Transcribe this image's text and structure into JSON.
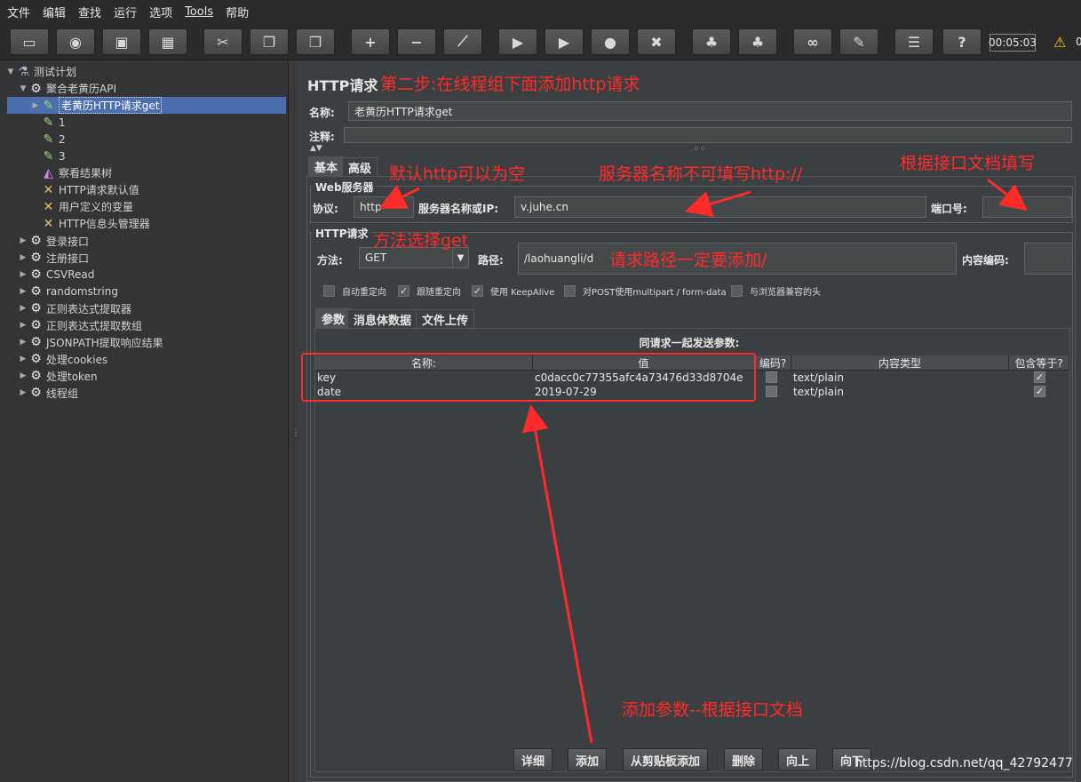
{
  "menu": [
    "文件",
    "编辑",
    "查找",
    "运行",
    "选项",
    "Tools",
    "帮助"
  ],
  "toolbar": {
    "buttons": [
      {
        "name": "new-plan-icon",
        "glyph": "▭"
      },
      {
        "name": "templates-icon",
        "glyph": "◉"
      },
      {
        "name": "open-icon",
        "glyph": "▣"
      },
      {
        "name": "save-icon",
        "glyph": "▦"
      },
      {
        "name": "cut-icon",
        "glyph": "✂"
      },
      {
        "name": "copy-icon",
        "glyph": "❐"
      },
      {
        "name": "paste-icon",
        "glyph": "❒"
      },
      {
        "name": "expand-icon",
        "glyph": "+"
      },
      {
        "name": "collapse-icon",
        "glyph": "−"
      },
      {
        "name": "toggle-icon",
        "glyph": "⟋"
      },
      {
        "name": "start-icon",
        "glyph": "▶"
      },
      {
        "name": "start-no-pause-icon",
        "glyph": "▶"
      },
      {
        "name": "stop-icon",
        "glyph": "●"
      },
      {
        "name": "shutdown-icon",
        "glyph": "✖"
      },
      {
        "name": "clear-icon",
        "glyph": "♣"
      },
      {
        "name": "clear-all-icon",
        "glyph": "♣"
      },
      {
        "name": "search-icon",
        "glyph": "∞"
      },
      {
        "name": "reset-search-icon",
        "glyph": "✎"
      },
      {
        "name": "function-helper-icon",
        "glyph": "☰"
      },
      {
        "name": "help-icon",
        "glyph": "?"
      }
    ],
    "timer": "00:05:03",
    "warning_count": "0"
  },
  "tree": [
    {
      "label": "测试计划",
      "icon": "flask-icon",
      "glyph": "⚗",
      "indent": 0,
      "arrow": "▼"
    },
    {
      "label": "聚合老黄历API",
      "icon": "gear-icon",
      "glyph": "⚙",
      "indent": 1,
      "arrow": "▼"
    },
    {
      "label": "老黄历HTTP请求get",
      "icon": "pipette-icon",
      "glyph": "✎",
      "indent": 2,
      "arrow": "▶",
      "selected": true
    },
    {
      "label": "1",
      "icon": "pipette-icon",
      "glyph": "✎",
      "indent": 2,
      "arrow": ""
    },
    {
      "label": "2",
      "icon": "pipette-icon",
      "glyph": "✎",
      "indent": 2,
      "arrow": ""
    },
    {
      "label": "3",
      "icon": "pipette-icon",
      "glyph": "✎",
      "indent": 2,
      "arrow": ""
    },
    {
      "label": "察看结果树",
      "icon": "chart-icon",
      "glyph": "◭",
      "indent": 2,
      "arrow": ""
    },
    {
      "label": "HTTP请求默认值",
      "icon": "wrench-icon",
      "glyph": "✕",
      "indent": 2,
      "arrow": ""
    },
    {
      "label": "用户定义的变量",
      "icon": "wrench-icon",
      "glyph": "✕",
      "indent": 2,
      "arrow": ""
    },
    {
      "label": "HTTP信息头管理器",
      "icon": "wrench-icon",
      "glyph": "✕",
      "indent": 2,
      "arrow": ""
    },
    {
      "label": "登录接口",
      "icon": "gear-icon",
      "glyph": "⚙",
      "indent": 1,
      "arrow": "▶"
    },
    {
      "label": "注册接口",
      "icon": "gear-icon",
      "glyph": "⚙",
      "indent": 1,
      "arrow": "▶"
    },
    {
      "label": "CSVRead",
      "icon": "gear-icon",
      "glyph": "⚙",
      "indent": 1,
      "arrow": "▶"
    },
    {
      "label": "randomstring",
      "icon": "gear-icon",
      "glyph": "⚙",
      "indent": 1,
      "arrow": "▶"
    },
    {
      "label": "正则表达式提取器",
      "icon": "gear-icon",
      "glyph": "⚙",
      "indent": 1,
      "arrow": "▶"
    },
    {
      "label": "正则表达式提取数组",
      "icon": "gear-icon",
      "glyph": "⚙",
      "indent": 1,
      "arrow": "▶"
    },
    {
      "label": "JSONPATH提取响应结果",
      "icon": "gear-icon",
      "glyph": "⚙",
      "indent": 1,
      "arrow": "▶"
    },
    {
      "label": "处理cookies",
      "icon": "gear-icon",
      "glyph": "⚙",
      "indent": 1,
      "arrow": "▶"
    },
    {
      "label": "处理token",
      "icon": "gear-icon",
      "glyph": "⚙",
      "indent": 1,
      "arrow": "▶"
    },
    {
      "label": "线程组",
      "icon": "gear-icon",
      "glyph": "⚙",
      "indent": 1,
      "arrow": "▶"
    }
  ],
  "panel": {
    "title": "HTTP请求",
    "name_label": "名称:",
    "name_value": "老黄历HTTP请求get",
    "comment_label": "注释:",
    "tabs": [
      "基本",
      "高级"
    ],
    "web_server": {
      "group_title": "Web服务器",
      "protocol_label": "协议:",
      "protocol_value": "http",
      "server_label": "服务器名称或IP:",
      "server_value": "v.juhe.cn",
      "port_label": "端口号:",
      "port_value": ""
    },
    "http_request": {
      "group_title": "HTTP请求",
      "method_label": "方法:",
      "method_value": "GET",
      "path_label": "路径:",
      "path_value": "/laohuangli/d",
      "encoding_label": "内容编码:",
      "encoding_value": ""
    },
    "options": [
      {
        "label": "自动重定向",
        "checked": false
      },
      {
        "label": "跟随重定向",
        "checked": true
      },
      {
        "label": "使用 KeepAlive",
        "checked": true
      },
      {
        "label": "对POST使用multipart / form-data",
        "checked": false
      },
      {
        "label": "与浏览器兼容的头",
        "checked": false
      }
    ],
    "subtabs": [
      "参数",
      "消息体数据",
      "文件上传"
    ],
    "params_caption": "同请求一起发送参数:",
    "columns": [
      "名称:",
      "值",
      "编码?",
      "内容类型",
      "包含等于?"
    ],
    "rows": [
      {
        "name": "key",
        "value": "c0dacc0c77355afc4a73476d33d8704e",
        "encode": false,
        "type": "text/plain",
        "include_equals": true
      },
      {
        "name": "date",
        "value": "2019-07-29",
        "encode": false,
        "type": "text/plain",
        "include_equals": true
      }
    ],
    "buttons": [
      "详细",
      "添加",
      "从剪贴板添加",
      "删除",
      "向上",
      "向下"
    ]
  },
  "annotations": {
    "step2": "第二步:在线程组下面添加http请求",
    "protocol_note": "默认http可以为空",
    "server_note": "服务器名称不可填写http://",
    "port_note": "根据接口文档填写",
    "method_note": "方法选择get",
    "path_note": "请求路径一定要添加/",
    "params_note": "添加参数--根据接口文档"
  },
  "watermark": "https://blog.csdn.net/qq_42792477",
  "colors": {
    "annotation": "#ff2a2a",
    "selection": "#4b6eaf",
    "panel": "#3c3f41"
  }
}
